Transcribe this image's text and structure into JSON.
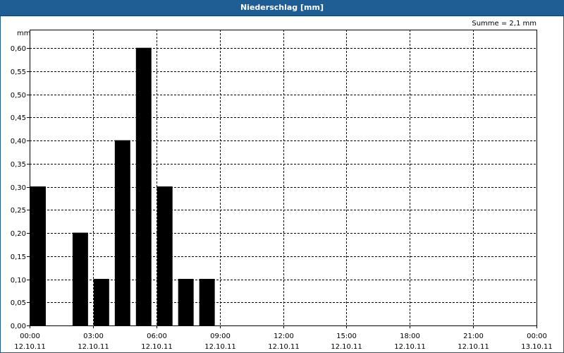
{
  "window": {
    "title": "Niederschlag [mm]"
  },
  "chart_data": {
    "type": "bar",
    "title": "Niederschlag [mm]",
    "annotation": "Summe = 2,1 mm",
    "ylabel": "mm",
    "ylim": [
      0,
      0.64
    ],
    "yticks": [
      {
        "v": 0.0,
        "label": "0,00"
      },
      {
        "v": 0.05,
        "label": "0,05"
      },
      {
        "v": 0.1,
        "label": "0,10"
      },
      {
        "v": 0.15,
        "label": "0,15"
      },
      {
        "v": 0.2,
        "label": "0,20"
      },
      {
        "v": 0.25,
        "label": "0,25"
      },
      {
        "v": 0.3,
        "label": "0,30"
      },
      {
        "v": 0.35,
        "label": "0,35"
      },
      {
        "v": 0.4,
        "label": "0,40"
      },
      {
        "v": 0.45,
        "label": "0,45"
      },
      {
        "v": 0.5,
        "label": "0,50"
      },
      {
        "v": 0.55,
        "label": "0,55"
      },
      {
        "v": 0.6,
        "label": "0,60"
      }
    ],
    "xlim_hours": [
      0,
      24
    ],
    "xticks": [
      {
        "h": 0,
        "time": "00:00",
        "date": "12.10.11"
      },
      {
        "h": 3,
        "time": "03:00",
        "date": "12.10.11"
      },
      {
        "h": 6,
        "time": "06:00",
        "date": "12.10.11"
      },
      {
        "h": 9,
        "time": "09:00",
        "date": "12.10.11"
      },
      {
        "h": 12,
        "time": "12:00",
        "date": "12.10.11"
      },
      {
        "h": 15,
        "time": "15:00",
        "date": "12.10.11"
      },
      {
        "h": 18,
        "time": "18:00",
        "date": "12.10.11"
      },
      {
        "h": 21,
        "time": "21:00",
        "date": "12.10.11"
      },
      {
        "h": 24,
        "time": "00:00",
        "date": "13.10.11"
      }
    ],
    "bars": [
      {
        "h": 0,
        "value": 0.3
      },
      {
        "h": 1,
        "value": 0.0
      },
      {
        "h": 2,
        "value": 0.2
      },
      {
        "h": 3,
        "value": 0.1
      },
      {
        "h": 4,
        "value": 0.4
      },
      {
        "h": 5,
        "value": 0.6
      },
      {
        "h": 6,
        "value": 0.3
      },
      {
        "h": 7,
        "value": 0.1
      },
      {
        "h": 8,
        "value": 0.1
      }
    ],
    "grid": true,
    "bar_color": "#000000"
  }
}
